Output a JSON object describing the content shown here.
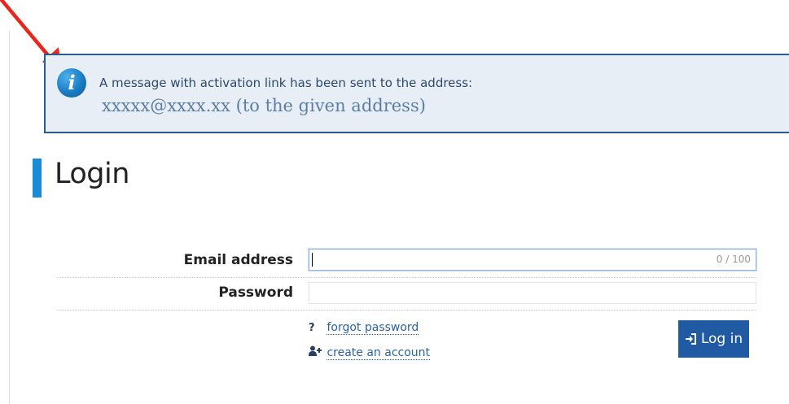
{
  "notice": {
    "line1": "A message with activation link has been sent to the address:",
    "line2": "xxxxx@xxxx.xx (to the given address)",
    "icon": "info-icon",
    "icon_glyph": "i"
  },
  "page": {
    "title": "Login"
  },
  "form": {
    "email_label": "Email address",
    "email_value": "",
    "email_counter": "0 / 100",
    "password_label": "Password",
    "password_value": ""
  },
  "links": {
    "forgot_icon": "?",
    "forgot_label": "forgot password",
    "create_label": "create an account"
  },
  "actions": {
    "login_label": "Log in"
  },
  "colors": {
    "accent": "#1a8bd6",
    "button": "#1f5aa3",
    "notice_bg": "#e8eef6",
    "notice_border": "#2c5c8d",
    "arrow": "#e8261c"
  }
}
